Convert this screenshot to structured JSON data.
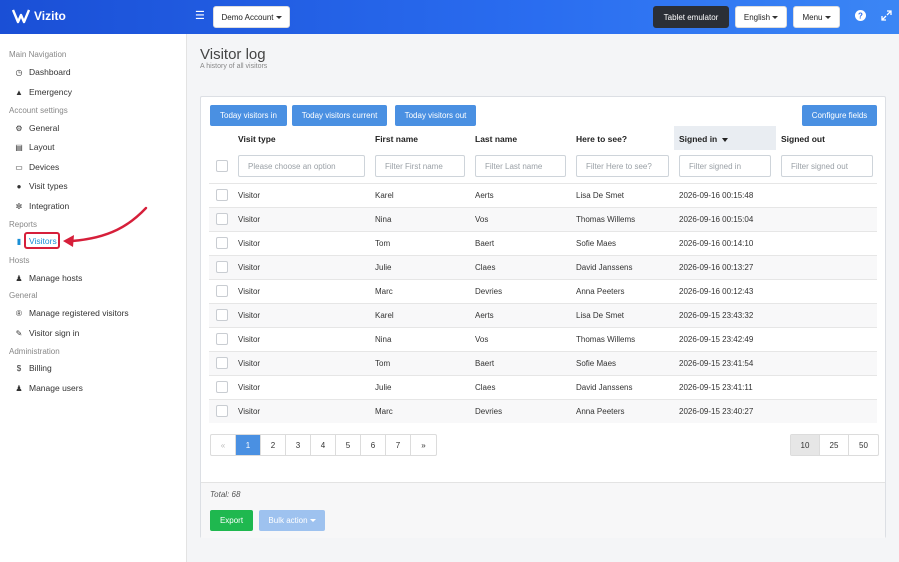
{
  "app": {
    "name": "Vizito"
  },
  "topbar": {
    "account": "Demo Account",
    "tablet": "Tablet emulator",
    "language": "English",
    "menu": "Menu"
  },
  "sidebar": {
    "sections": [
      {
        "title": "Main Navigation",
        "items": [
          {
            "label": "Dashboard",
            "icon": "dashboard-icon"
          },
          {
            "label": "Emergency",
            "icon": "warning-icon"
          }
        ]
      },
      {
        "title": "Account settings",
        "items": [
          {
            "label": "General",
            "icon": "gear-icon"
          },
          {
            "label": "Layout",
            "icon": "image-icon"
          },
          {
            "label": "Devices",
            "icon": "desktop-icon"
          },
          {
            "label": "Visit types",
            "icon": "users-icon"
          },
          {
            "label": "Integration",
            "icon": "plug-icon"
          }
        ]
      },
      {
        "title": "Reports",
        "items": [
          {
            "label": "Visitors",
            "icon": "book-icon"
          }
        ]
      },
      {
        "title": "Hosts",
        "items": [
          {
            "label": "Manage hosts",
            "icon": "user-icon"
          }
        ]
      },
      {
        "title": "General",
        "items": [
          {
            "label": "Manage registered visitors",
            "icon": "registered-icon"
          },
          {
            "label": "Visitor sign in",
            "icon": "pencil-icon"
          }
        ]
      },
      {
        "title": "Administration",
        "items": [
          {
            "label": "Billing",
            "icon": "dollar-icon"
          },
          {
            "label": "Manage users",
            "icon": "user-plus-icon"
          }
        ]
      }
    ]
  },
  "page": {
    "title": "Visitor log",
    "subtitle": "A history of all visitors"
  },
  "toolbar": {
    "today_in": "Today visitors in",
    "today_current": "Today visitors current",
    "today_out": "Today visitors out",
    "configure": "Configure fields"
  },
  "table": {
    "columns": [
      "Visit type",
      "First name",
      "Last name",
      "Here to see?",
      "Signed in",
      "Signed out"
    ],
    "filters": [
      "Please choose an option",
      "Filter First name",
      "Filter Last name",
      "Filter Here to see?",
      "Filter signed in",
      "Filter signed out"
    ],
    "rows": [
      [
        "Visitor",
        "Karel",
        "Aerts",
        "Lisa De Smet",
        "2026-09-16 00:15:48",
        ""
      ],
      [
        "Visitor",
        "Nina",
        "Vos",
        "Thomas Willems",
        "2026-09-16 00:15:04",
        ""
      ],
      [
        "Visitor",
        "Tom",
        "Baert",
        "Sofie Maes",
        "2026-09-16 00:14:10",
        ""
      ],
      [
        "Visitor",
        "Julie",
        "Claes",
        "David Janssens",
        "2026-09-16 00:13:27",
        ""
      ],
      [
        "Visitor",
        "Marc",
        "Devries",
        "Anna Peeters",
        "2026-09-16 00:12:43",
        ""
      ],
      [
        "Visitor",
        "Karel",
        "Aerts",
        "Lisa De Smet",
        "2026-09-15 23:43:32",
        ""
      ],
      [
        "Visitor",
        "Nina",
        "Vos",
        "Thomas Willems",
        "2026-09-15 23:42:49",
        ""
      ],
      [
        "Visitor",
        "Tom",
        "Baert",
        "Sofie Maes",
        "2026-09-15 23:41:54",
        ""
      ],
      [
        "Visitor",
        "Julie",
        "Claes",
        "David Janssens",
        "2026-09-15 23:41:11",
        ""
      ],
      [
        "Visitor",
        "Marc",
        "Devries",
        "Anna Peeters",
        "2026-09-15 23:40:27",
        ""
      ]
    ]
  },
  "pagination": {
    "pages": [
      "«",
      "1",
      "2",
      "3",
      "4",
      "5",
      "6",
      "7",
      "»"
    ],
    "current": "1",
    "sizes": [
      "10",
      "25",
      "50"
    ],
    "size_selected": "10"
  },
  "footer": {
    "total": "Total: 68",
    "export": "Export",
    "bulk": "Bulk action"
  }
}
